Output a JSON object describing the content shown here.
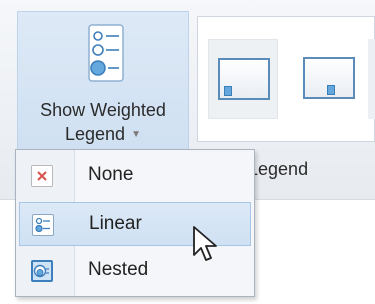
{
  "ribbon": {
    "weighted_legend_button": {
      "label_line1": "Show Weighted",
      "label_line2": "Legend",
      "icon": "weighted-legend-icon"
    },
    "group_label_visible": "d Legend"
  },
  "dropdown": {
    "items": [
      {
        "label": "None",
        "icon": "none-icon"
      },
      {
        "label": "Linear",
        "icon": "linear-legend-icon",
        "state": "hovered"
      },
      {
        "label": "Nested",
        "icon": "nested-legend-icon"
      }
    ]
  },
  "colors": {
    "highlight": "#cfe0f2",
    "accent": "#3d7fbc",
    "none_x": "#d9534f"
  }
}
